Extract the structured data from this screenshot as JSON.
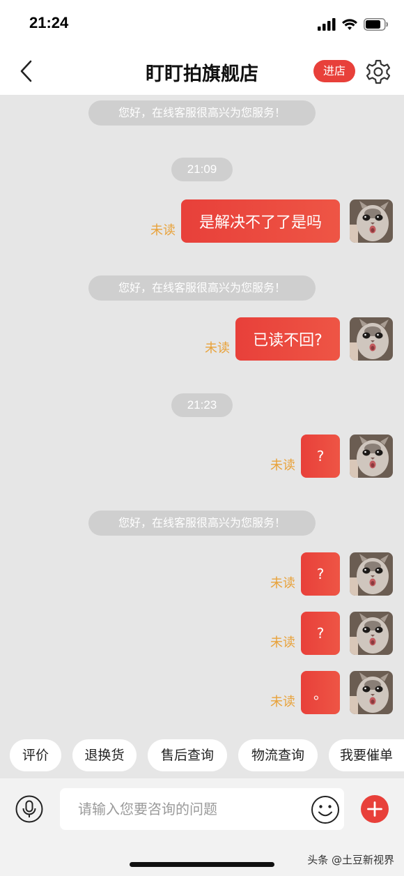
{
  "status_bar": {
    "time": "21:24"
  },
  "header": {
    "title": "盯盯拍旗舰店",
    "visit_store_label": "进店",
    "back_icon": "chevron-left-icon",
    "settings_icon": "gear-icon"
  },
  "messages": [
    {
      "type": "system",
      "text": "您好，在线客服很高兴为您服务！"
    },
    {
      "type": "time",
      "text": "21:09"
    },
    {
      "type": "sent",
      "text": "是解决不了了是吗",
      "status": "未读"
    },
    {
      "type": "system",
      "text": "您好，在线客服很高兴为您服务！"
    },
    {
      "type": "sent",
      "text": "已读不回?",
      "status": "未读"
    },
    {
      "type": "time",
      "text": "21:23"
    },
    {
      "type": "sent",
      "text": "?",
      "status": "未读"
    },
    {
      "type": "system",
      "text": "您好，在线客服很高兴为您服务！"
    },
    {
      "type": "sent",
      "text": "?",
      "status": "未读"
    },
    {
      "type": "sent",
      "text": "?",
      "status": "未读"
    },
    {
      "type": "sent",
      "text": "。",
      "status": "未读"
    }
  ],
  "quick_actions": [
    "评价",
    "退换货",
    "售后查询",
    "物流查询",
    "我要催单"
  ],
  "input": {
    "placeholder": "请输入您要咨询的问题"
  },
  "watermark": "头条 @土豆新视界",
  "colors": {
    "accent": "#e8403a",
    "unread": "#e8a23a",
    "background": "#e6e6e6"
  }
}
